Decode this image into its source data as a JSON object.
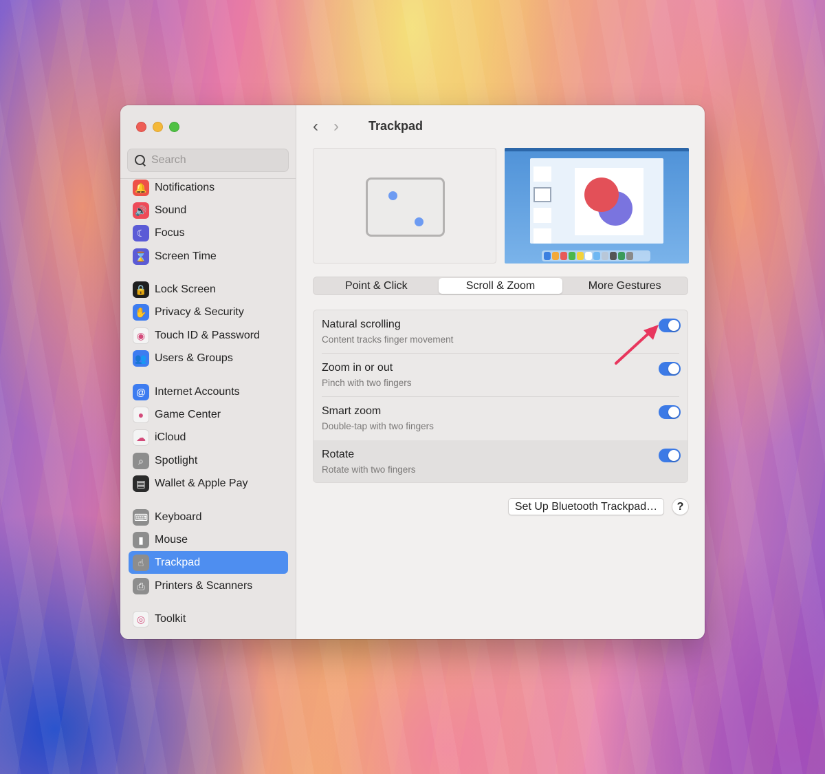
{
  "window": {
    "title": "Trackpad",
    "back_icon": "‹",
    "forward_icon": "›"
  },
  "search": {
    "placeholder": "Search"
  },
  "sidebar": {
    "items": [
      {
        "label": "Notifications",
        "icon": "bell-icon",
        "glyph": "🔔",
        "color": "#ee5147"
      },
      {
        "label": "Sound",
        "icon": "speaker-icon",
        "glyph": "🔊",
        "color": "#ee4a58"
      },
      {
        "label": "Focus",
        "icon": "moon-icon",
        "glyph": "☾",
        "color": "#5b5bd6"
      },
      {
        "label": "Screen Time",
        "icon": "hourglass-icon",
        "glyph": "⌛",
        "color": "#5b5bd6"
      },
      {
        "label": "Lock Screen",
        "icon": "lock-icon",
        "glyph": "🔒",
        "color": "#1f1f1f"
      },
      {
        "label": "Privacy & Security",
        "icon": "hand-icon",
        "glyph": "✋",
        "color": "#3d7cf0"
      },
      {
        "label": "Touch ID & Password",
        "icon": "fingerprint-icon",
        "glyph": "◉",
        "color": "#f4f4f4"
      },
      {
        "label": "Users & Groups",
        "icon": "users-icon",
        "glyph": "👥",
        "color": "#3d7cf0"
      },
      {
        "label": "Internet Accounts",
        "icon": "at-icon",
        "glyph": "@",
        "color": "#3d7cf0"
      },
      {
        "label": "Game Center",
        "icon": "game-center-icon",
        "glyph": "●",
        "color": "#f4f4f4"
      },
      {
        "label": "iCloud",
        "icon": "cloud-icon",
        "glyph": "☁",
        "color": "#f4f4f4"
      },
      {
        "label": "Spotlight",
        "icon": "magnifier-icon",
        "glyph": "⌕",
        "color": "#8d8d8d"
      },
      {
        "label": "Wallet & Apple Pay",
        "icon": "wallet-icon",
        "glyph": "▤",
        "color": "#2b2b2b"
      },
      {
        "label": "Keyboard",
        "icon": "keyboard-icon",
        "glyph": "⌨",
        "color": "#8d8d8d"
      },
      {
        "label": "Mouse",
        "icon": "mouse-icon",
        "glyph": "▮",
        "color": "#8d8d8d"
      },
      {
        "label": "Trackpad",
        "icon": "trackpad-icon",
        "glyph": "☝",
        "color": "#8d8d8d"
      },
      {
        "label": "Printers & Scanners",
        "icon": "printer-icon",
        "glyph": "⎙",
        "color": "#8d8d8d"
      },
      {
        "label": "Toolkit",
        "icon": "toolkit-icon",
        "glyph": "◎",
        "color": "#f4f4f4"
      }
    ]
  },
  "tabs": [
    {
      "label": "Point & Click",
      "selected": false
    },
    {
      "label": "Scroll & Zoom",
      "selected": true
    },
    {
      "label": "More Gestures",
      "selected": false
    }
  ],
  "settings": [
    {
      "title": "Natural scrolling",
      "subtitle": "Content tracks finger movement",
      "enabled": true
    },
    {
      "title": "Zoom in or out",
      "subtitle": "Pinch with two fingers",
      "enabled": true
    },
    {
      "title": "Smart zoom",
      "subtitle": "Double-tap with two fingers",
      "enabled": true
    },
    {
      "title": "Rotate",
      "subtitle": "Rotate with two fingers",
      "enabled": true
    }
  ],
  "buttons": {
    "bluetooth": "Set Up Bluetooth Trackpad…",
    "help": "?"
  },
  "colors": {
    "accent": "#3c7ae6",
    "sidebar_selected": "#4e8ef0",
    "annotation_arrow": "#e8365d"
  }
}
